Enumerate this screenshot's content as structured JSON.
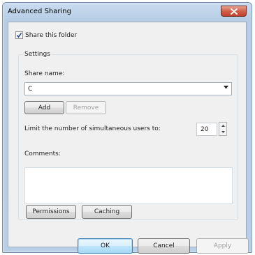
{
  "window": {
    "title": "Advanced Sharing",
    "close_icon": "close-icon"
  },
  "share_folder": {
    "label": "Share this folder",
    "checked": true
  },
  "settings": {
    "group_label": "Settings",
    "share_name_label": "Share name:",
    "share_name_value": "C",
    "add_label": "Add",
    "remove_label": "Remove",
    "limit_label": "Limit the number of simultaneous users to:",
    "limit_value": "20",
    "comments_label": "Comments:",
    "comments_value": "",
    "permissions_label": "Permissions",
    "caching_label": "Caching"
  },
  "footer": {
    "ok_label": "OK",
    "cancel_label": "Cancel",
    "apply_label": "Apply"
  },
  "colors": {
    "titlebar": "#b9cfe7",
    "close_button": "#c4402c",
    "dialog_bg": "#f0f0f0"
  }
}
